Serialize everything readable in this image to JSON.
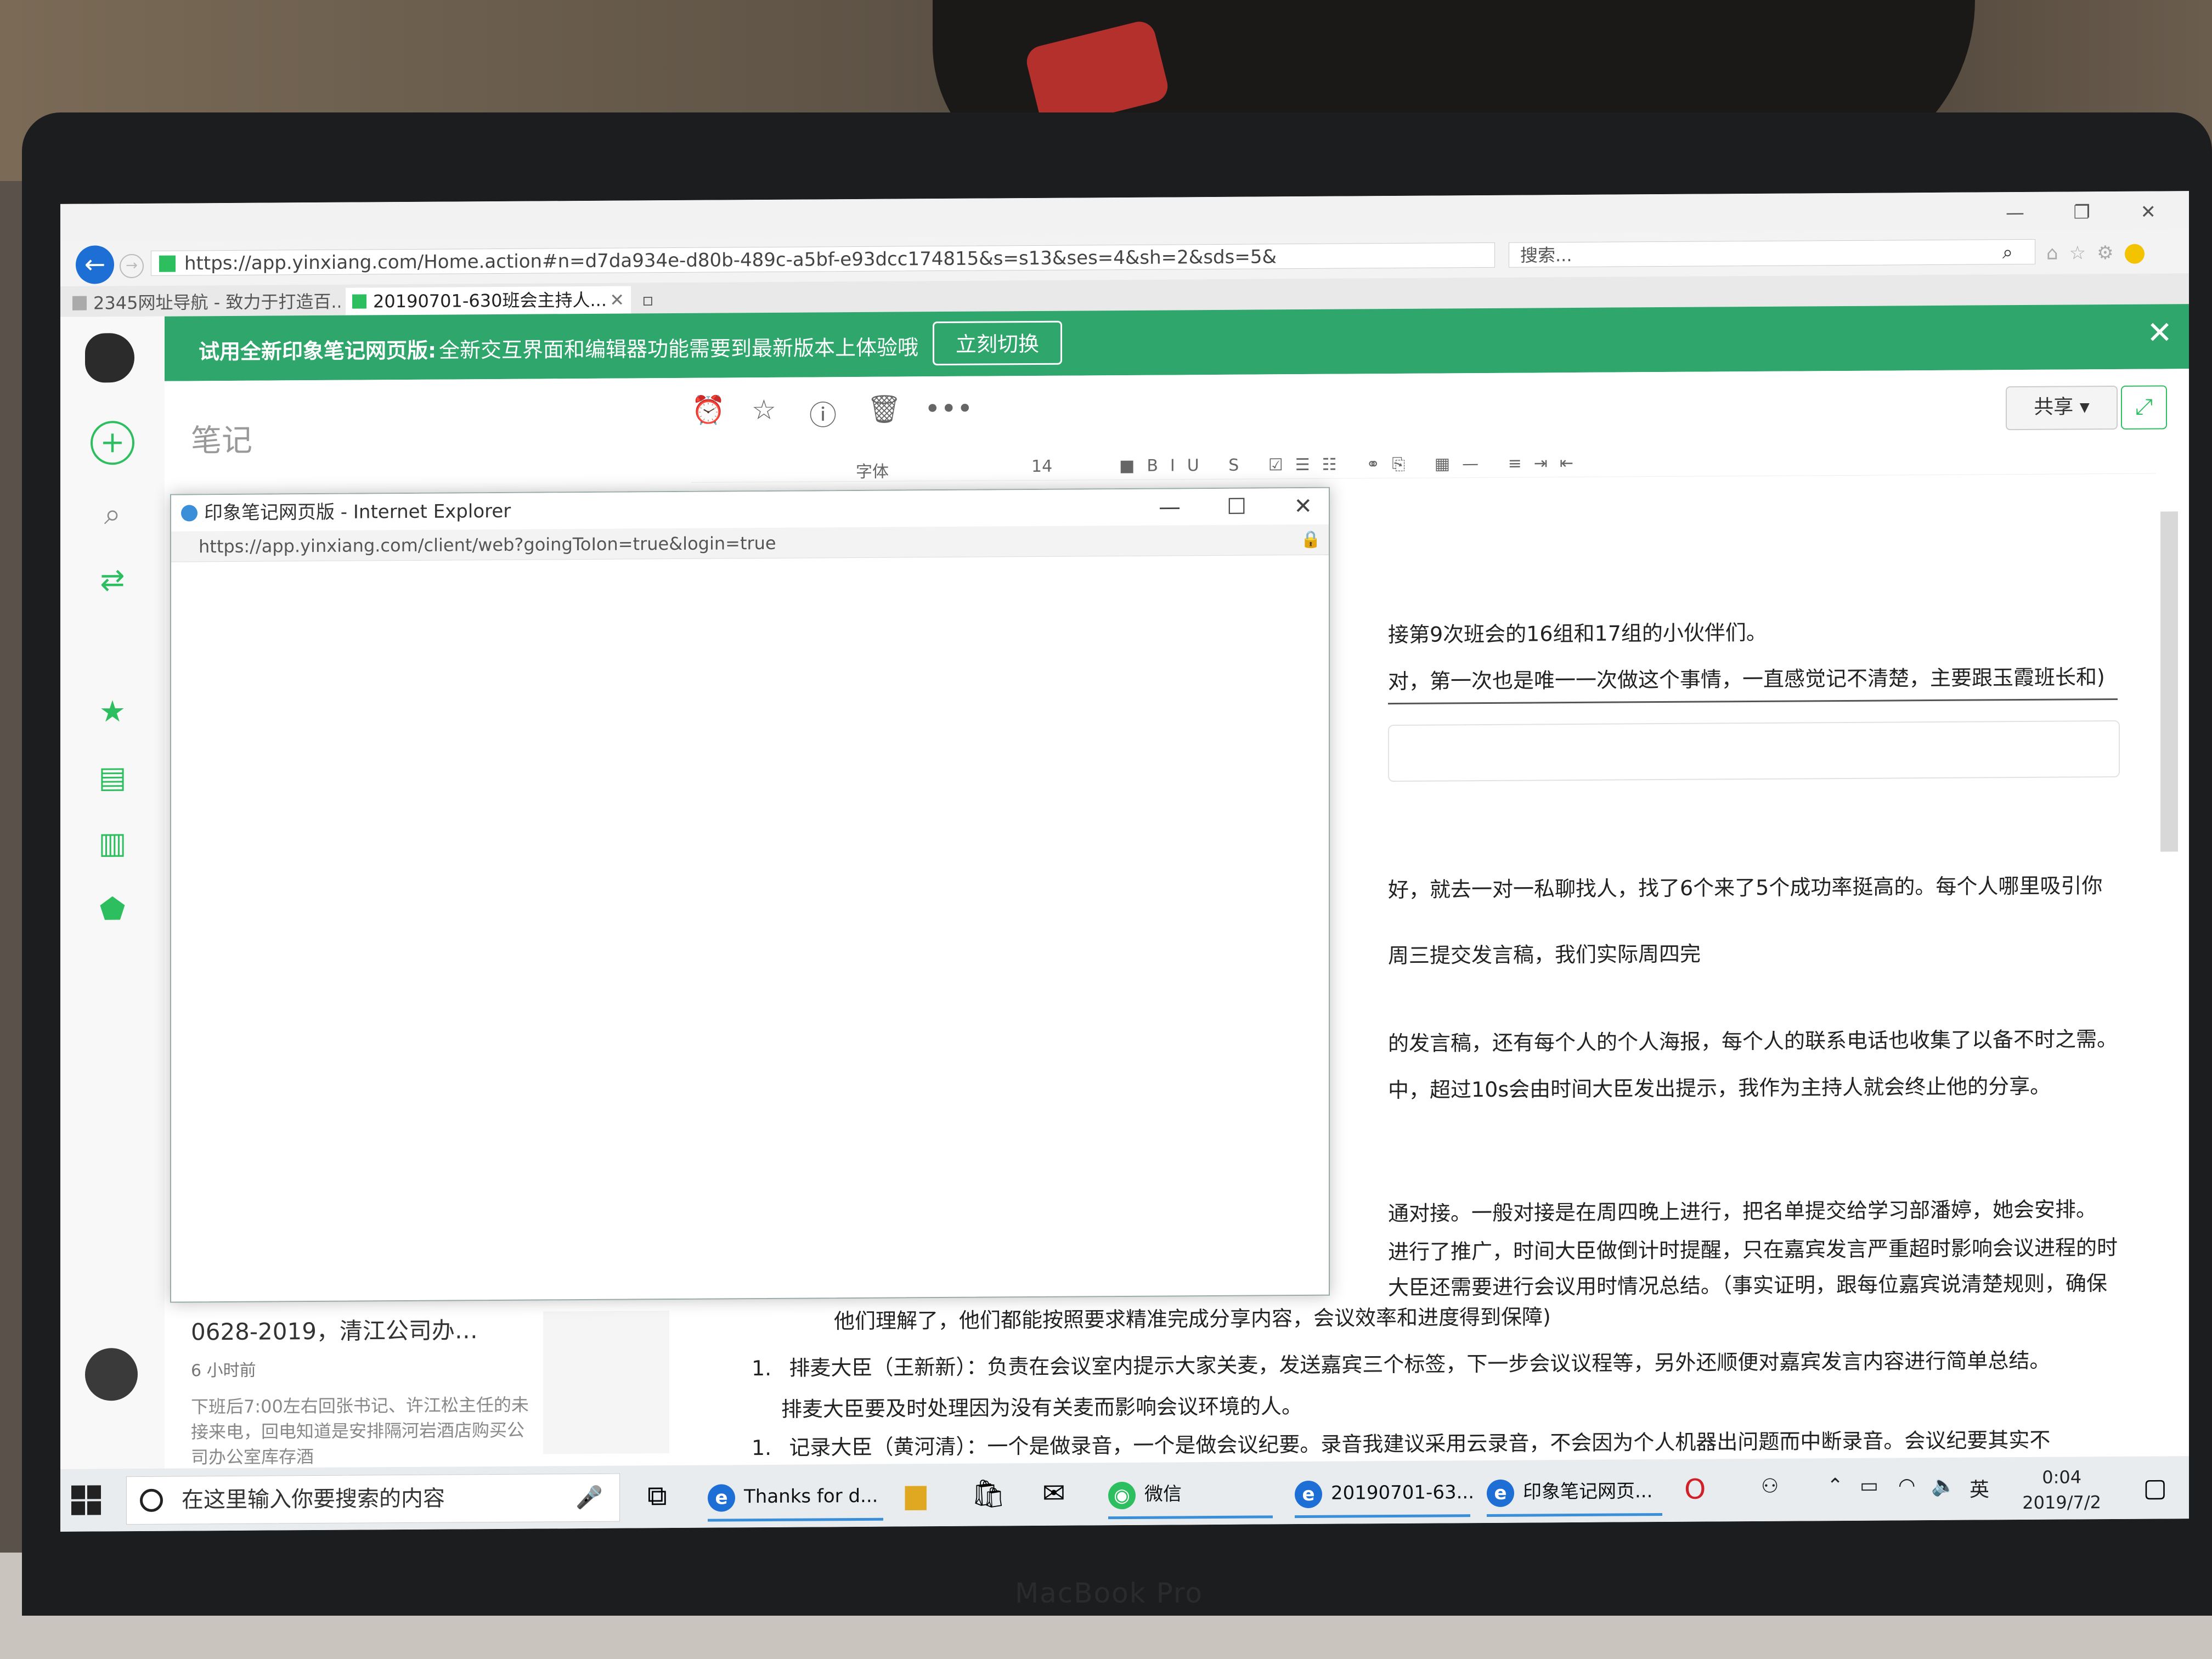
{
  "browser": {
    "url": "https://app.yinxiang.com/Home.action#n=d7da934e-d80b-489c-a5bf-e93dcc174815&s=s13&ses=4&sh=2&sds=5&",
    "search_placeholder": "搜索...",
    "tabs": [
      {
        "label": "2345网址导航 - 致力于打造百..."
      },
      {
        "label": "20190701-630班会主持人..."
      }
    ]
  },
  "banner": {
    "title": "试用全新印象笔记网页版:",
    "text": "全新交互界面和编辑器功能需要到最新版本上体验哦",
    "button": "立刻切换"
  },
  "notelist": {
    "title": "笔记",
    "snippet": {
      "title": "0628-2019，清江公司办…",
      "time": "6 小时前",
      "body": "下班后7:00左右回张书记、许江松主任的未接来电，回电知道是安排隔河岩酒店购买公司办公室库存酒"
    }
  },
  "editor": {
    "share_label": "共享",
    "format_font": "字体",
    "format_size": "14",
    "lines": [
      "接第9次班会的16组和17组的小伙伴们。",
      "对，第一次也是唯一一次做这个事情，一直感觉记不清楚，主要跟玉霞班长和)",
      "好，就去一对一私聊找人，找了6个来了5个成功率挺高的。每个人哪里吸引你",
      "周三提交发言稿，我们实际周四完",
      "的发言稿，还有每个人的个人海报，每个人的联系电话也收集了以备不时之需。",
      "中，超过10s会由时间大臣发出提示，我作为主持人就会终止他的分享。",
      "通对接。一般对接是在周四晚上进行，把名单提交给学习部潘婷，她会安排。",
      "进行了推广，时间大臣做倒计时提醒，只在嘉宾发言严重超时影响会议进程的时",
      "大臣还需要进行会议用时情况总结。（事实证明，跟每位嘉宾说清楚规则，确保",
      "他们理解了，他们都能按照要求精准完成分享内容，会议效率和进度得到保障)"
    ],
    "list_items": [
      {
        "num": "1.",
        "line1": "排麦大臣（王新新）：负责在会议室内提示大家关麦，发送嘉宾三个标签，下一步会议议程等，另外还顺便对嘉宾发言内容进行简单总结。",
        "line2": "排麦大臣要及时处理因为没有关麦而影响会议环境的人。"
      },
      {
        "num": "1.",
        "line1": "记录大臣（黄河清）：一个是做录音，一个是做会议纪要。录音我建议采用云录音，不会因为个人机器出问题而中断录音。会议纪要其实不"
      }
    ]
  },
  "popup": {
    "title": "印象笔记网页版 - Internet Explorer",
    "url": "https://app.yinxiang.com/client/web?goingToIon=true&login=true"
  },
  "taskbar": {
    "search_placeholder": "在这里输入你要搜索的内容",
    "items": [
      {
        "label": "Thanks for d..."
      },
      {
        "label": "微信"
      },
      {
        "label": "20190701-63..."
      },
      {
        "label": "印象笔记网页..."
      }
    ],
    "ime": "英",
    "time": "0:04",
    "date": "2019/7/2"
  },
  "device_label": "MacBook Pro",
  "colors": {
    "accent": "#2dbe60",
    "banner": "#2fa66b",
    "ie_blue": "#1d6fd6"
  }
}
